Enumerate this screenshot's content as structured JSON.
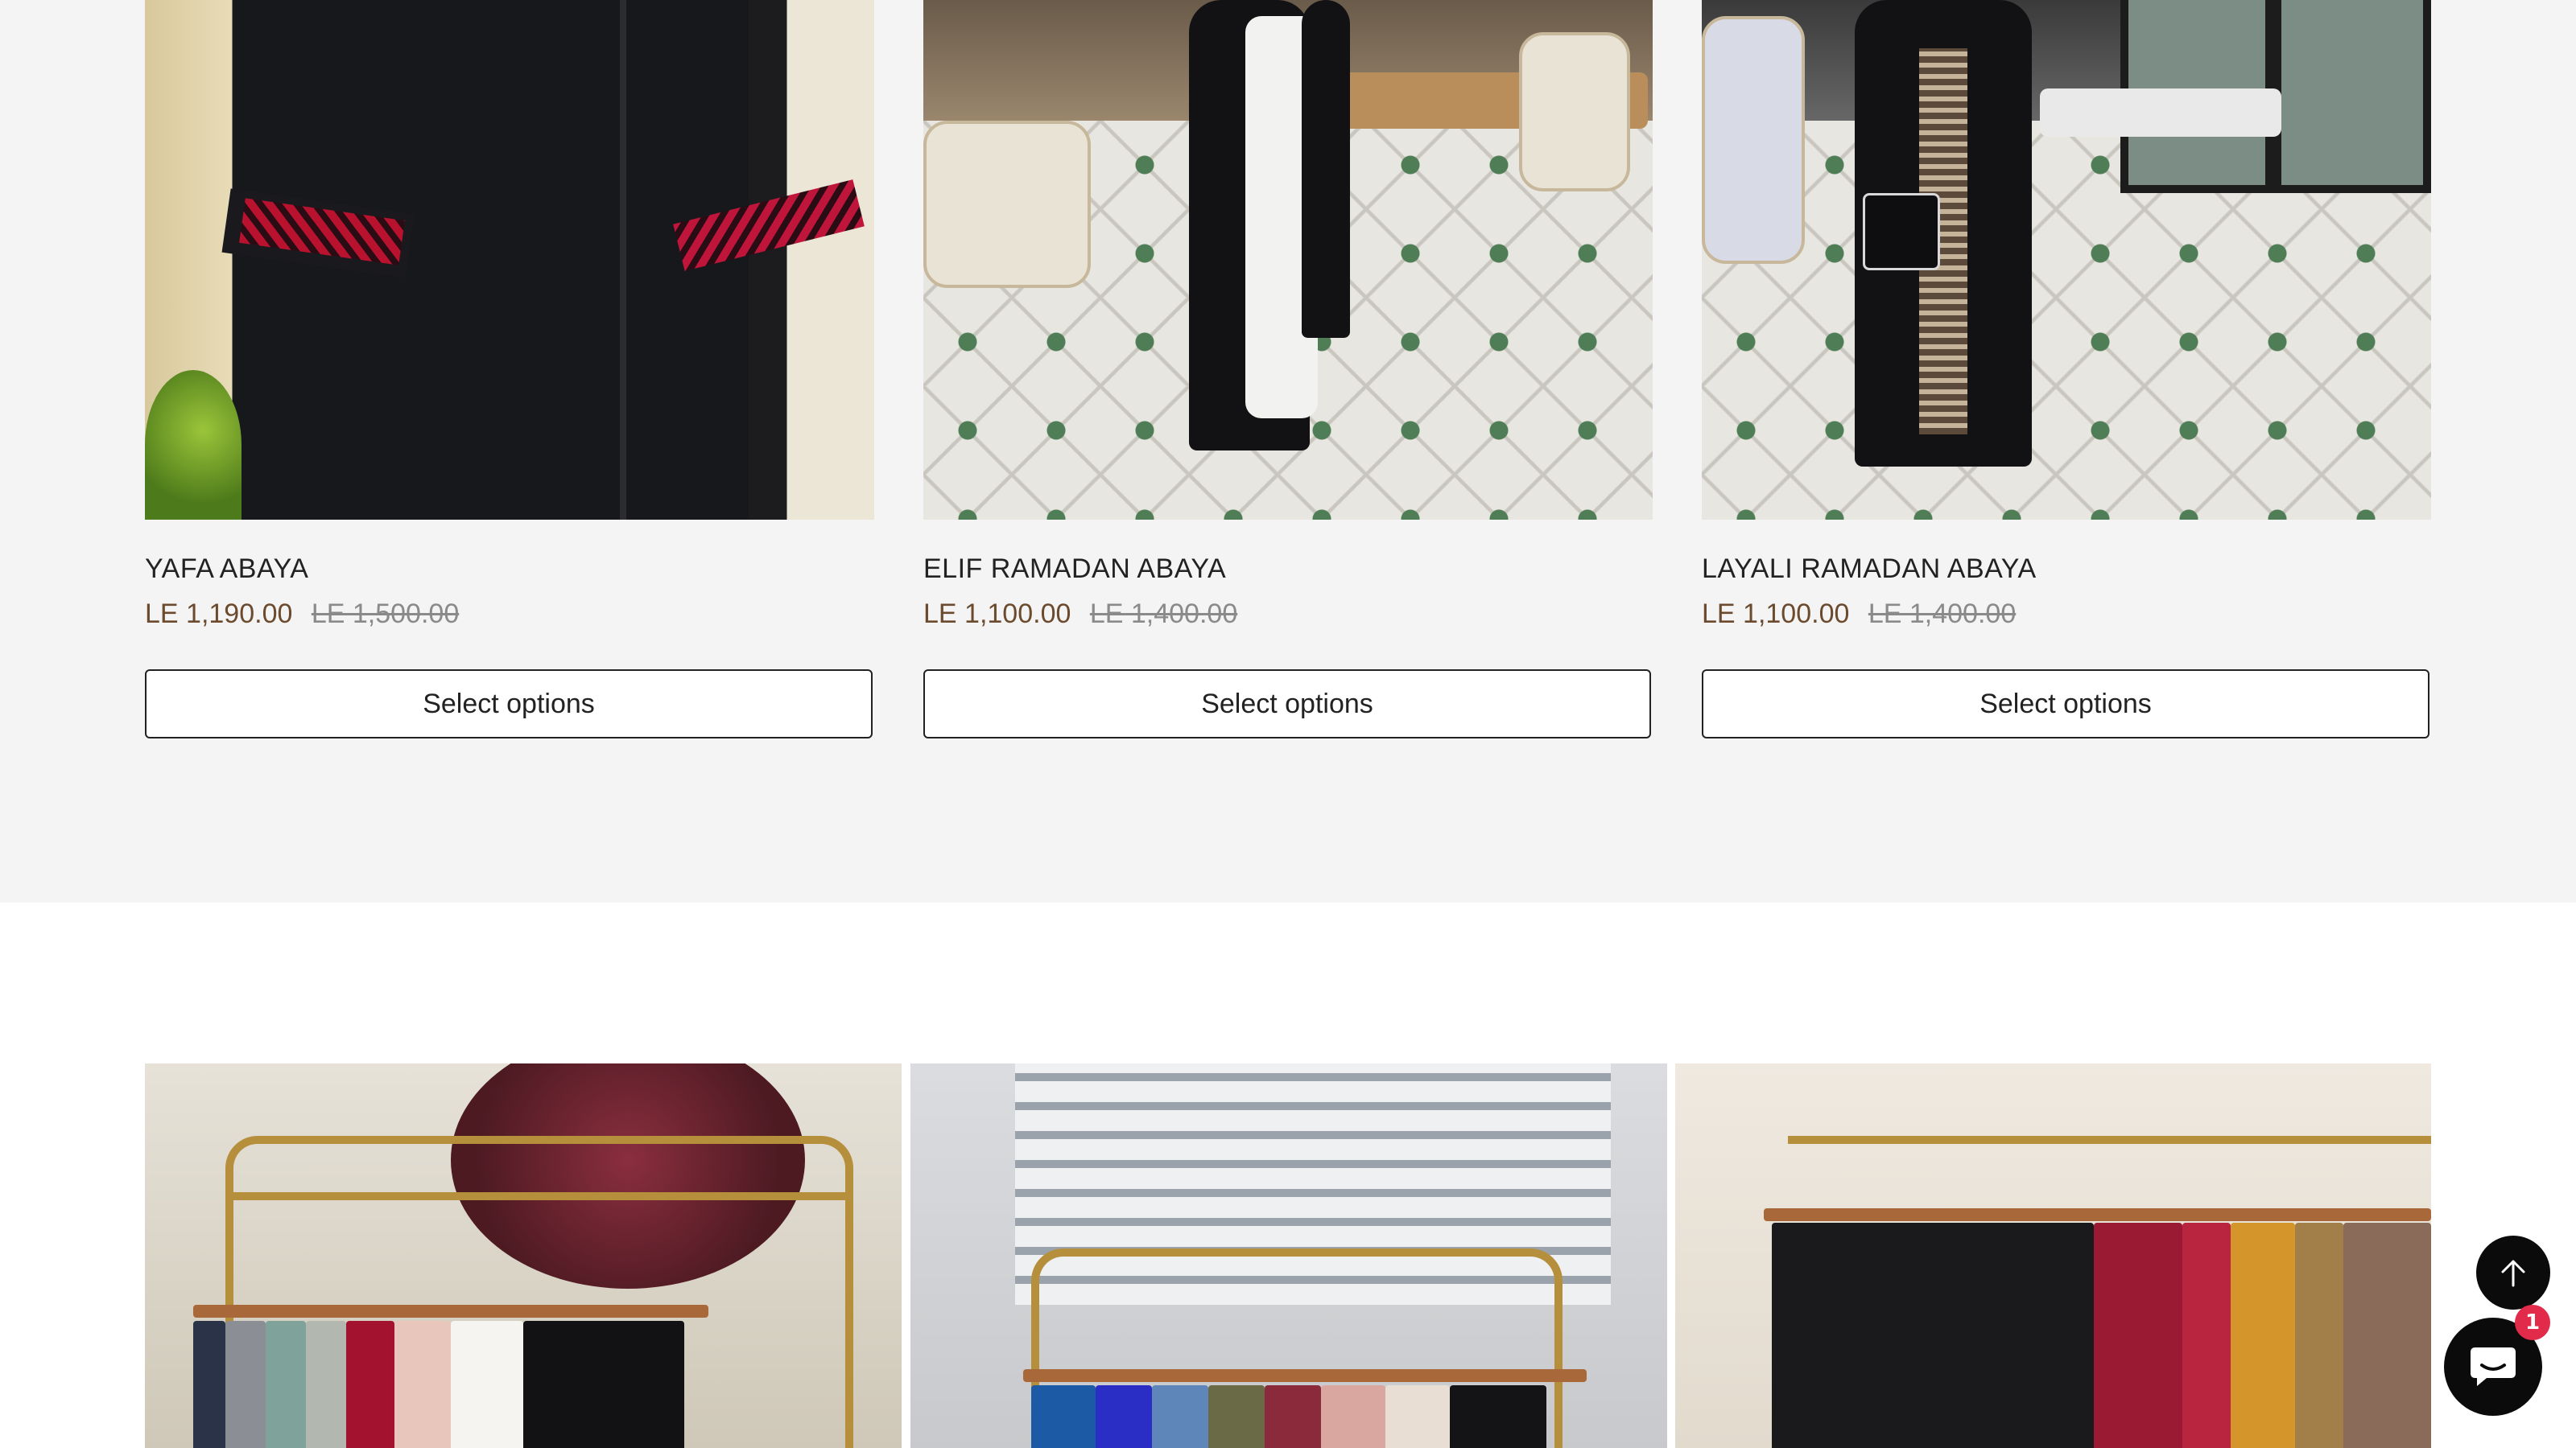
{
  "products": [
    {
      "title": "YAFA ABAYA",
      "sale_price": "LE 1,190.00",
      "original_price": "LE 1,500.00",
      "button_label": "Select options"
    },
    {
      "title": "ELIF RAMADAN ABAYA",
      "sale_price": "LE 1,100.00",
      "original_price": "LE 1,400.00",
      "button_label": "Select options"
    },
    {
      "title": "LAYALI RAMADAN ABAYA",
      "sale_price": "LE 1,100.00",
      "original_price": "LE 1,400.00",
      "button_label": "Select options"
    }
  ],
  "floating": {
    "back_to_top_icon": "arrow-up-icon",
    "chat_icon": "chat-bubble-icon",
    "chat_badge_count": "1"
  },
  "colors": {
    "section_background": "#f4f4f4",
    "sale_price": "#6b4a2e",
    "original_price": "#8a8a8a",
    "badge": "#e22a4a"
  }
}
